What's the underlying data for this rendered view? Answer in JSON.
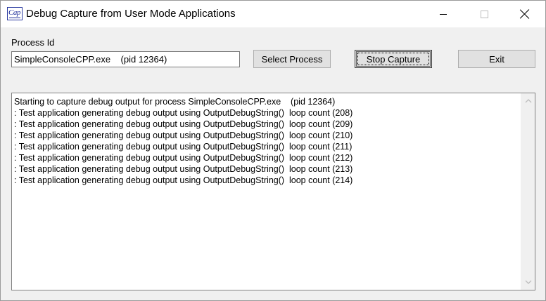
{
  "window": {
    "title": "Debug Capture from User Mode Applications",
    "icon_label": "Cap",
    "caption_buttons": [
      "minimize-icon",
      "maximize-icon",
      "close-icon"
    ]
  },
  "form": {
    "process_label": "Process Id",
    "process_value": "SimpleConsoleCPP.exe    (pid 12364)"
  },
  "buttons": {
    "select_process": "Select Process",
    "stop_capture": "Stop Capture",
    "exit": "Exit"
  },
  "output": {
    "lines": [
      "Starting to capture debug output for process SimpleConsoleCPP.exe    (pid 12364)",
      ": Test application generating debug output using OutputDebugString()  loop count (208)",
      ": Test application generating debug output using OutputDebugString()  loop count (209)",
      ": Test application generating debug output using OutputDebugString()  loop count (210)",
      ": Test application generating debug output using OutputDebugString()  loop count (211)",
      ": Test application generating debug output using OutputDebugString()  loop count (212)",
      ": Test application generating debug output using OutputDebugString()  loop count (213)",
      ": Test application generating debug output using OutputDebugString()  loop count (214)"
    ]
  },
  "colors": {
    "window_bg": "#f0f0f0",
    "button_bg": "#e1e1e1",
    "icon_accent": "#1a2a98"
  }
}
